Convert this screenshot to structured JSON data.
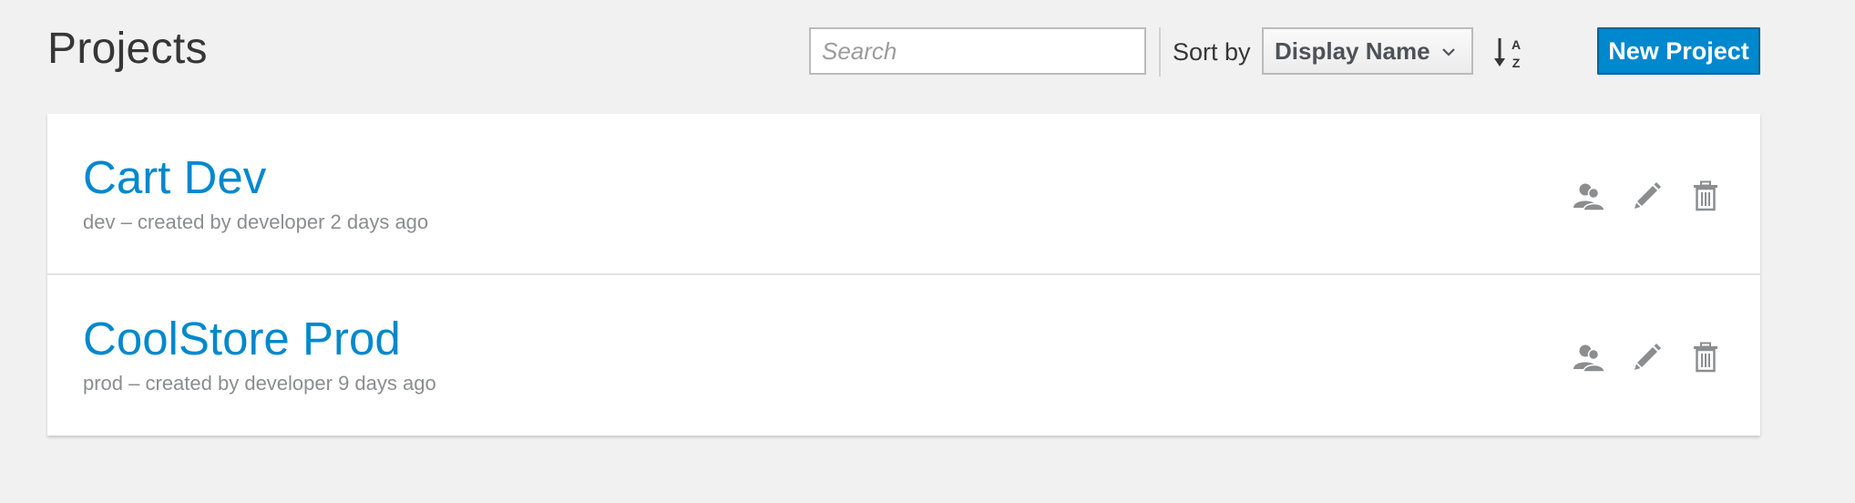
{
  "header": {
    "title": "Projects"
  },
  "toolbar": {
    "search_placeholder": "Search",
    "sort_label": "Sort by",
    "sort_value": "Display Name",
    "sort_direction_icon": "sort-alpha-asc-icon",
    "new_project_label": "New Project"
  },
  "projects": [
    {
      "name": "Cart Dev",
      "meta": "dev – created by developer 2 days ago"
    },
    {
      "name": "CoolStore Prod",
      "meta": "prod – created by developer 9 days ago"
    }
  ],
  "row_actions": [
    "members-icon",
    "edit-icon",
    "delete-icon"
  ],
  "colors": {
    "accent": "#0088ce",
    "background": "#f1f1f1",
    "icon": "#8b8d8f"
  }
}
